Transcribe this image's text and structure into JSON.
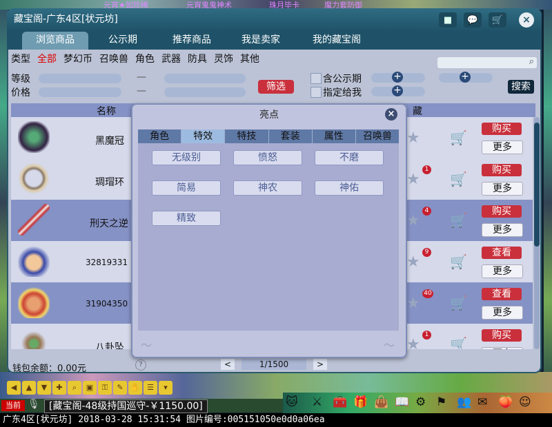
{
  "window": {
    "title": "藏宝阁-广东4区[状元坊]",
    "tabs": [
      "浏览商品",
      "公示期",
      "推荐商品",
      "我是卖家",
      "我的藏宝阁"
    ],
    "active_tab": 0
  },
  "background_ticker": [
    "元宵★如珍稀",
    "元宵鬼鬼神术",
    "珠月毕卡",
    "魔力套防御"
  ],
  "categories": {
    "label": "类型",
    "items": [
      "全部",
      "梦幻币",
      "召唤兽",
      "角色",
      "武器",
      "防具",
      "灵饰",
      "其他"
    ],
    "active": "全部"
  },
  "filters": {
    "level_label": "等级",
    "price_label": "价格",
    "dash": "—",
    "filter_button": "筛选",
    "option_public": "含公示期",
    "option_assigned": "指定给我",
    "search_button": "搜索"
  },
  "table": {
    "headers": [
      "名称",
      "藏"
    ],
    "rows": [
      {
        "name": "黑魔冠",
        "badge": "",
        "action": "购买",
        "more": "更多"
      },
      {
        "name": "琱瑁环",
        "badge": "1",
        "action": "购买",
        "more": "更多"
      },
      {
        "name": "刑天之逆",
        "badge": "4",
        "action": "购买",
        "more": "更多"
      },
      {
        "name": "32819331",
        "badge": "9",
        "action": "查看",
        "more": "更多"
      },
      {
        "name": "31904350",
        "badge": "40",
        "action": "查看",
        "more": "更多"
      },
      {
        "name": "八卦坠",
        "badge": "1",
        "action": "购买",
        "more": "更多"
      }
    ]
  },
  "footer": {
    "wallet": "钱包余额：0.00元",
    "help": "?",
    "prev": "<",
    "page": "1/1500",
    "next": ">"
  },
  "modal": {
    "title": "亮点",
    "close": "×",
    "tabs": [
      "角色",
      "特效",
      "特技",
      "套装",
      "属性",
      "召唤兽"
    ],
    "active_tab": 1,
    "options": [
      "无级别",
      "愤怒",
      "不磨",
      "简易",
      "神农",
      "神佑",
      "精致"
    ]
  },
  "game": {
    "chat_channel": "当前",
    "chat_text": "[藏宝阁-48级持国巡守-￥1150.00]",
    "status_line": "广东4区[状元坊] 2018-03-28 15:31:54 图片编号:005151050e0d0a06ea"
  },
  "colors": {
    "titlebar": "#1f5268",
    "buy_button": "#c9303c",
    "row_dark": "#8592c6",
    "row_light": "#d5d9ea",
    "modal_bg": "#c1c4de"
  }
}
